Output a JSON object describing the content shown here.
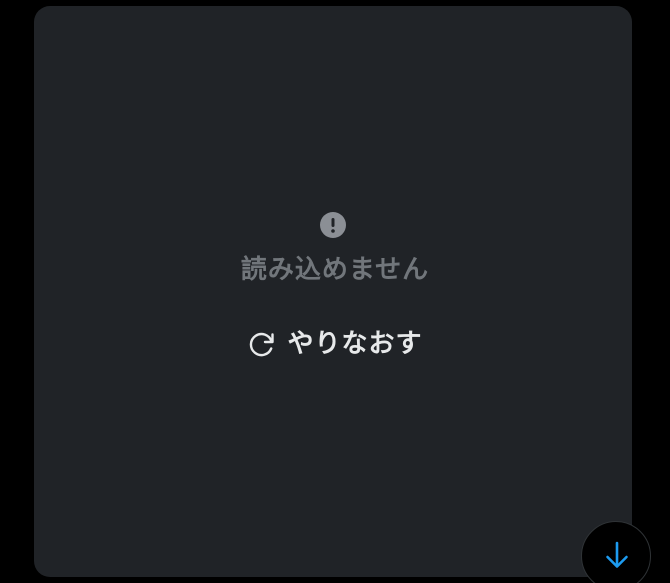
{
  "error": {
    "message": "読み込めません",
    "icon": "exclamation-circle-icon"
  },
  "retry": {
    "label": "やりなおす",
    "icon": "refresh-icon"
  },
  "scroll_button": {
    "icon": "arrow-down-icon"
  },
  "colors": {
    "background": "#000000",
    "card": "#202327",
    "muted_text": "#71767b",
    "icon_gray": "#8b8f95",
    "primary_text": "#e7e9ea",
    "accent": "#1d9bf0"
  }
}
